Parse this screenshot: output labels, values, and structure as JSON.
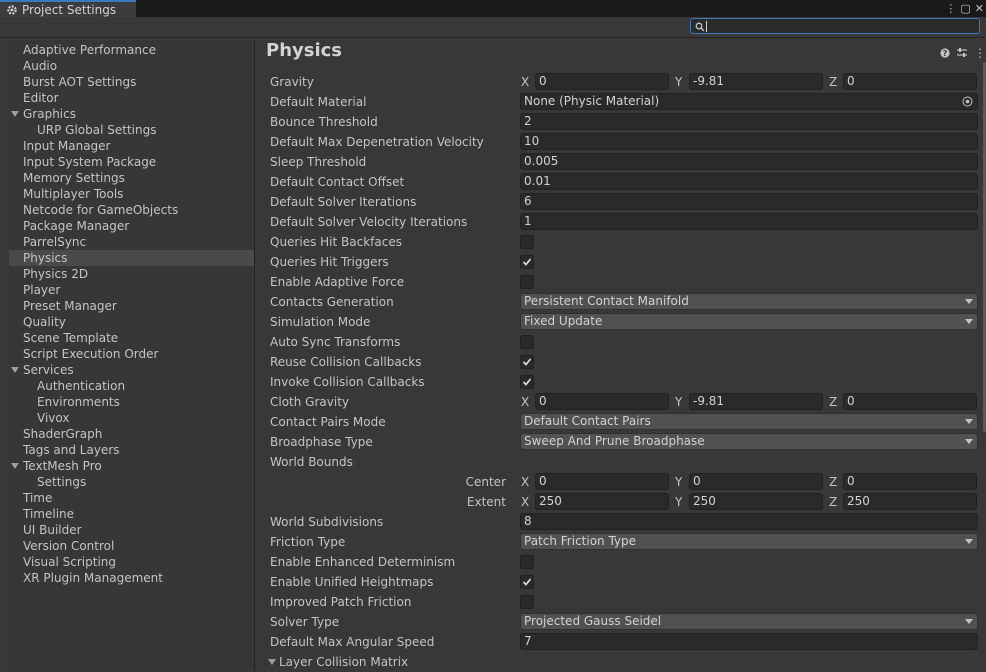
{
  "window": {
    "title": "Project Settings"
  },
  "search": {
    "value": ""
  },
  "sidebar": {
    "items": [
      {
        "label": "Adaptive Performance",
        "indent": 0
      },
      {
        "label": "Audio",
        "indent": 0
      },
      {
        "label": "Burst AOT Settings",
        "indent": 0
      },
      {
        "label": "Editor",
        "indent": 0
      },
      {
        "label": "Graphics",
        "indent": 0,
        "expanded": true
      },
      {
        "label": "URP Global Settings",
        "indent": 1
      },
      {
        "label": "Input Manager",
        "indent": 0
      },
      {
        "label": "Input System Package",
        "indent": 0
      },
      {
        "label": "Memory Settings",
        "indent": 0
      },
      {
        "label": "Multiplayer Tools",
        "indent": 0
      },
      {
        "label": "Netcode for GameObjects",
        "indent": 0
      },
      {
        "label": "Package Manager",
        "indent": 0
      },
      {
        "label": "ParrelSync",
        "indent": 0
      },
      {
        "label": "Physics",
        "indent": 0,
        "selected": true
      },
      {
        "label": "Physics 2D",
        "indent": 0
      },
      {
        "label": "Player",
        "indent": 0
      },
      {
        "label": "Preset Manager",
        "indent": 0
      },
      {
        "label": "Quality",
        "indent": 0
      },
      {
        "label": "Scene Template",
        "indent": 0
      },
      {
        "label": "Script Execution Order",
        "indent": 0
      },
      {
        "label": "Services",
        "indent": 0,
        "expanded": true
      },
      {
        "label": "Authentication",
        "indent": 1
      },
      {
        "label": "Environments",
        "indent": 1
      },
      {
        "label": "Vivox",
        "indent": 1
      },
      {
        "label": "ShaderGraph",
        "indent": 0
      },
      {
        "label": "Tags and Layers",
        "indent": 0
      },
      {
        "label": "TextMesh Pro",
        "indent": 0,
        "expanded": true
      },
      {
        "label": "Settings",
        "indent": 1
      },
      {
        "label": "Time",
        "indent": 0
      },
      {
        "label": "Timeline",
        "indent": 0
      },
      {
        "label": "UI Builder",
        "indent": 0
      },
      {
        "label": "Version Control",
        "indent": 0
      },
      {
        "label": "Visual Scripting",
        "indent": 0
      },
      {
        "label": "XR Plugin Management",
        "indent": 0
      }
    ]
  },
  "main": {
    "title": "Physics",
    "rows": [
      {
        "label": "Gravity",
        "type": "vec3",
        "x": "0",
        "y": "-9.81",
        "z": "0"
      },
      {
        "label": "Default Material",
        "type": "object",
        "value": "None (Physic Material)"
      },
      {
        "label": "Bounce Threshold",
        "type": "text",
        "value": "2"
      },
      {
        "label": "Default Max Depenetration Velocity",
        "type": "text",
        "value": "10"
      },
      {
        "label": "Sleep Threshold",
        "type": "text",
        "value": "0.005"
      },
      {
        "label": "Default Contact Offset",
        "type": "text",
        "value": "0.01"
      },
      {
        "label": "Default Solver Iterations",
        "type": "text",
        "value": "6"
      },
      {
        "label": "Default Solver Velocity Iterations",
        "type": "text",
        "value": "1"
      },
      {
        "label": "Queries Hit Backfaces",
        "type": "check",
        "checked": false
      },
      {
        "label": "Queries Hit Triggers",
        "type": "check",
        "checked": true
      },
      {
        "label": "Enable Adaptive Force",
        "type": "check",
        "checked": false
      },
      {
        "label": "Contacts Generation",
        "type": "dropdown",
        "value": "Persistent Contact Manifold"
      },
      {
        "label": "Simulation Mode",
        "type": "dropdown",
        "value": "Fixed Update"
      },
      {
        "label": "Auto Sync Transforms",
        "type": "check",
        "checked": false
      },
      {
        "label": "Reuse Collision Callbacks",
        "type": "check",
        "checked": true
      },
      {
        "label": "Invoke Collision Callbacks",
        "type": "check",
        "checked": true
      },
      {
        "label": "Cloth Gravity",
        "type": "vec3",
        "x": "0",
        "y": "-9.81",
        "z": "0"
      },
      {
        "label": "Contact Pairs Mode",
        "type": "dropdown",
        "value": "Default Contact Pairs"
      },
      {
        "label": "Broadphase Type",
        "type": "dropdown",
        "value": "Sweep And Prune Broadphase"
      },
      {
        "label": "World Bounds",
        "type": "header"
      },
      {
        "label": "",
        "sublabel": "Center",
        "type": "vec3",
        "x": "0",
        "y": "0",
        "z": "0"
      },
      {
        "label": "",
        "sublabel": "Extent",
        "type": "vec3",
        "x": "250",
        "y": "250",
        "z": "250"
      },
      {
        "label": "World Subdivisions",
        "type": "text",
        "value": "8"
      },
      {
        "label": "Friction Type",
        "type": "dropdown",
        "value": "Patch Friction Type"
      },
      {
        "label": "Enable Enhanced Determinism",
        "type": "check",
        "checked": false
      },
      {
        "label": "Enable Unified Heightmaps",
        "type": "check",
        "checked": true
      },
      {
        "label": "Improved Patch Friction",
        "type": "check",
        "checked": false
      },
      {
        "label": "Solver Type",
        "type": "dropdown",
        "value": "Projected Gauss Seidel"
      },
      {
        "label": "Default Max Angular Speed",
        "type": "text",
        "value": "7"
      }
    ],
    "foldout_label": "Layer Collision Matrix",
    "axis_x": "X",
    "axis_y": "Y",
    "axis_z": "Z"
  },
  "icons": {
    "gear": "gear-icon",
    "search": "search-icon",
    "help": "help-icon",
    "presets": "presets-icon",
    "more": "more-menu-icon"
  }
}
